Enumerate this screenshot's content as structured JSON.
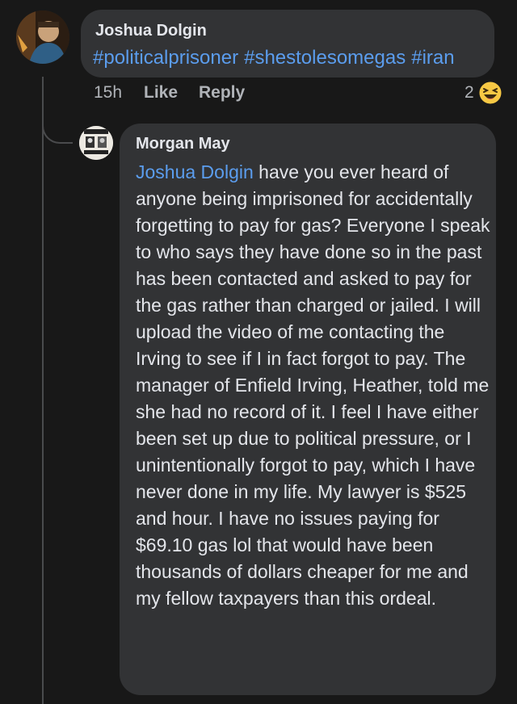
{
  "parent_comment": {
    "author": "Joshua Dolgin",
    "hashtags": [
      "#politicalprisoner",
      "#shestolesomegas",
      "#iran"
    ],
    "time": "15h",
    "like_label": "Like",
    "reply_label": "Reply",
    "reaction_count": "2",
    "reaction_icon": "laughing-emoji-icon"
  },
  "reply_comment": {
    "author": "Morgan May",
    "mention": "Joshua Dolgin",
    "text": " have you ever heard of anyone being imprisoned for accidentally forgetting to pay for gas? Everyone I speak to who says they have done so in the past has been contacted and asked to pay for the gas rather than charged or jailed. I will upload the video of me contacting the Irving to see if I in fact forgot to pay. The manager of Enfield Irving, Heather, told me she had no record of it. I feel I have either been set up due to political pressure, or I unintentionally forgot to pay, which I have never done in my life. My lawyer is $525 and hour. I have no issues paying for $69.10 gas lol that would have been thousands of dollars cheaper for me and my fellow taxpayers than this ordeal."
  },
  "colors": {
    "background": "#181818",
    "bubble": "#323335",
    "link": "#5b9dee",
    "text": "#e4e6eb",
    "muted": "#b0b3b8"
  }
}
